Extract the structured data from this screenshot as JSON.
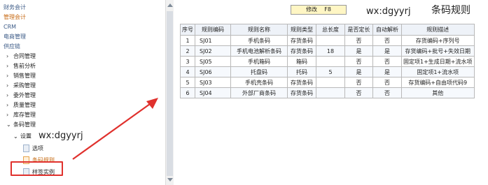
{
  "sidebar": {
    "top_items": [
      "财务会计",
      "管理会计",
      "CRM",
      "电商管理",
      "供应链"
    ],
    "groups": [
      "合同管理",
      "售前分析",
      "销售管理",
      "采购管理",
      "委外管理",
      "质量管理",
      "库存管理"
    ],
    "barcode_group": "条码管理",
    "settings_label": "设置",
    "watermark": "wx:dgyyrj",
    "leaf_items": [
      "选项",
      "条码规则",
      "样签实例"
    ]
  },
  "toolbar": {
    "edit_label": "修改",
    "edit_shortcut": "F8",
    "watermark": "wx:dgyyrj",
    "title": "条码规则"
  },
  "table": {
    "headers": [
      "序号",
      "规则编码",
      "规则名称",
      "规则类型",
      "总长度",
      "是否定长",
      "自动解析",
      "规则描述"
    ],
    "rows": [
      [
        "1",
        "SJ01",
        "手机条码",
        "存货条码",
        "",
        "否",
        "否",
        "存货编码+序列号"
      ],
      [
        "2",
        "SJ02",
        "手机电池解析条码",
        "存货条码",
        "18",
        "是",
        "是",
        "存货编码+批号+失效日期"
      ],
      [
        "3",
        "SJ05",
        "手机箱码",
        "箱码",
        "",
        "否",
        "否",
        "固定项1+生成日期+流水项"
      ],
      [
        "4",
        "SJ06",
        "托盘码",
        "托码",
        "5",
        "是",
        "是",
        "固定项1+流水项"
      ],
      [
        "5",
        "SJ03",
        "手机壳条码",
        "存货条码",
        "",
        "否",
        "否",
        "存货编码+自由项代码9"
      ],
      [
        "6",
        "SJ04",
        "外部厂商条码",
        "存货条码",
        "",
        "否",
        "否",
        "其他"
      ]
    ]
  },
  "colors": {
    "highlight_text": "#c76a14",
    "annotation_red": "#e0312d",
    "header_bg": "#eef2f8"
  }
}
